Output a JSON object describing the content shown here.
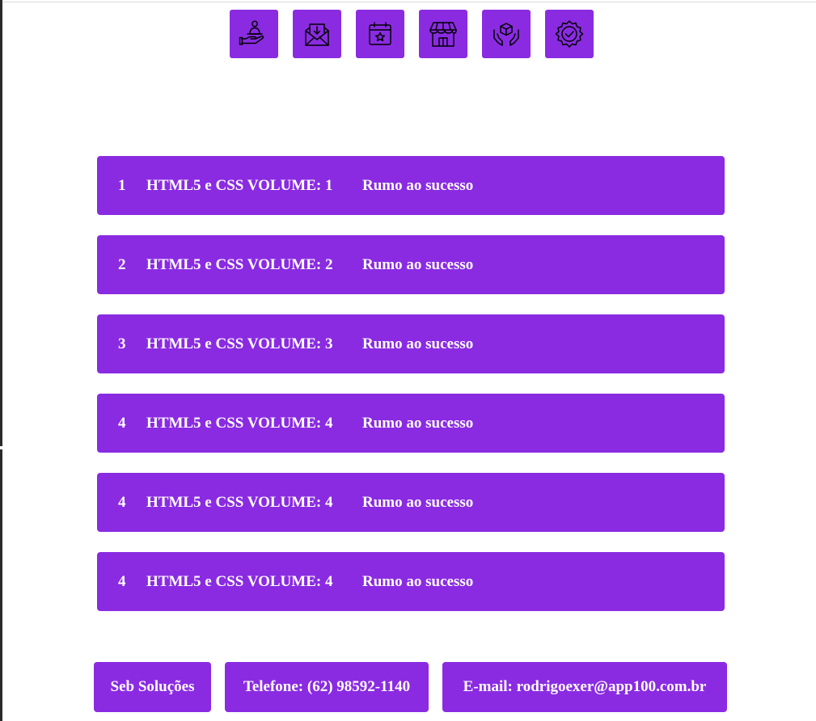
{
  "theme": {
    "accent": "#8a2be2",
    "text_on_accent": "#ffffff",
    "icon_stroke": "#000000"
  },
  "icons": [
    {
      "name": "hand-person-icon"
    },
    {
      "name": "mail-inbox-icon"
    },
    {
      "name": "calendar-star-icon"
    },
    {
      "name": "storefront-icon"
    },
    {
      "name": "hands-box-icon"
    },
    {
      "name": "badge-check-icon"
    }
  ],
  "books": [
    {
      "number": "1",
      "title": "HTML5 e CSS VOLUME: 1",
      "subtitle": "Rumo ao sucesso"
    },
    {
      "number": "2",
      "title": "HTML5 e CSS VOLUME: 2",
      "subtitle": "Rumo ao sucesso"
    },
    {
      "number": "3",
      "title": "HTML5 e CSS VOLUME: 3",
      "subtitle": "Rumo ao sucesso"
    },
    {
      "number": "4",
      "title": "HTML5 e CSS VOLUME: 4",
      "subtitle": "Rumo ao sucesso"
    },
    {
      "number": "4",
      "title": "HTML5 e CSS VOLUME: 4",
      "subtitle": "Rumo ao sucesso"
    },
    {
      "number": "4",
      "title": "HTML5 e CSS VOLUME: 4",
      "subtitle": "Rumo ao sucesso"
    }
  ],
  "footer": {
    "company": "Seb Soluções",
    "phone": "Telefone: (62) 98592-1140",
    "email": "E-mail: rodrigoexer@app100.com.br"
  }
}
